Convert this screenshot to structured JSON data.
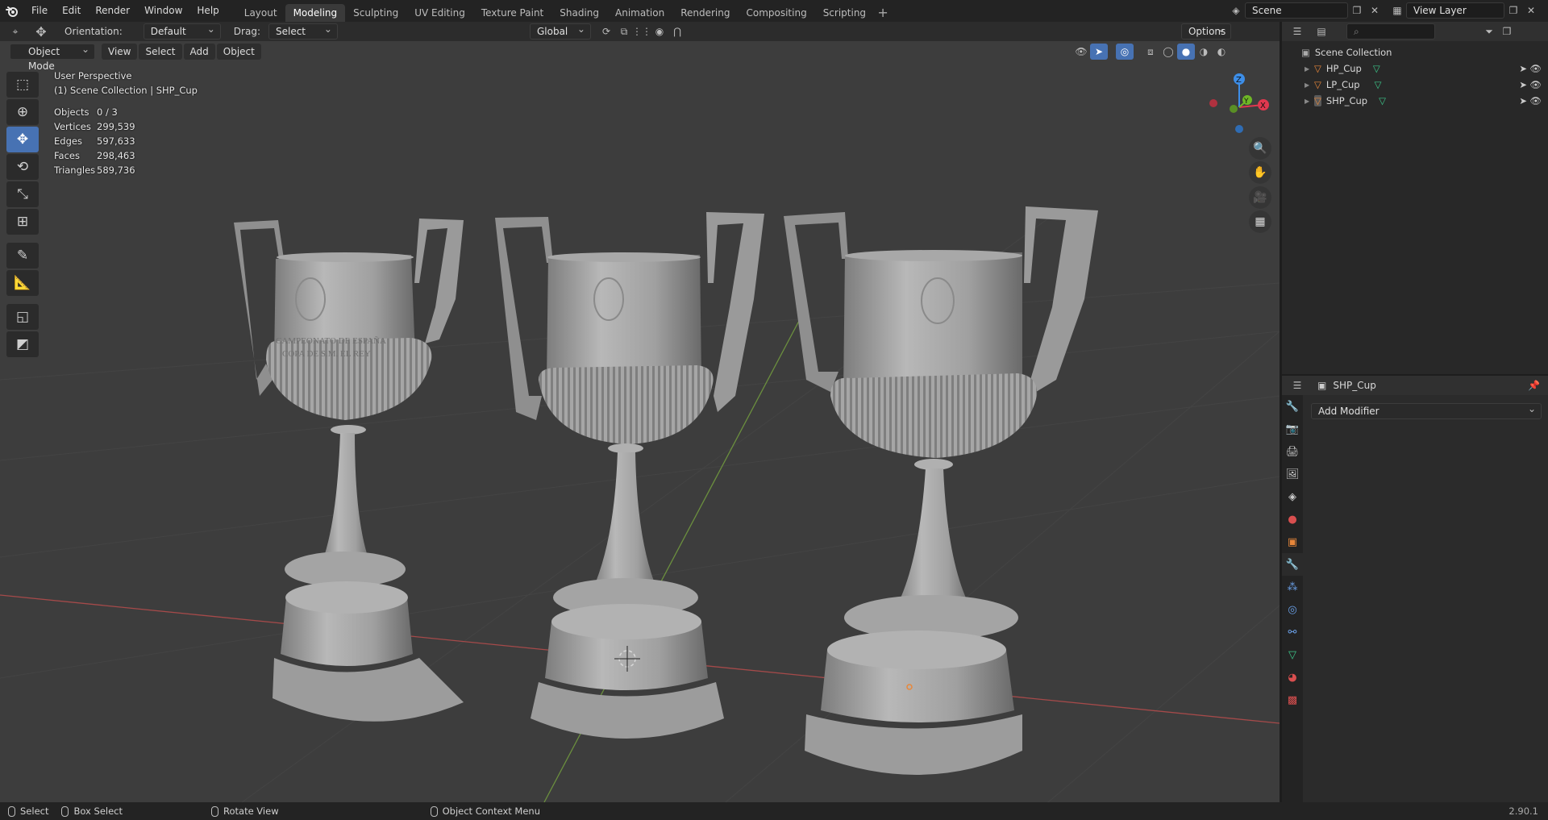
{
  "app": {
    "menus": [
      "File",
      "Edit",
      "Render",
      "Window",
      "Help"
    ],
    "workspace_tabs": [
      "Layout",
      "Modeling",
      "Sculpting",
      "UV Editing",
      "Texture Paint",
      "Shading",
      "Animation",
      "Rendering",
      "Compositing",
      "Scripting"
    ],
    "active_tab": "Modeling",
    "scene": "Scene",
    "view_layer": "View Layer"
  },
  "header": {
    "orientation_label": "Orientation:",
    "orientation_value": "Default",
    "drag_label": "Drag:",
    "drag_value": "Select Box",
    "transform_orientation": "Global",
    "options": "Options"
  },
  "viewport": {
    "mode": "Object Mode",
    "menus": [
      "View",
      "Select",
      "Add",
      "Object"
    ],
    "perspective": "User Perspective",
    "collection": "(1) Scene Collection | SHP_Cup",
    "stats": [
      {
        "label": "Objects",
        "value": "0 / 3"
      },
      {
        "label": "Vertices",
        "value": "299,539"
      },
      {
        "label": "Edges",
        "value": "597,633"
      },
      {
        "label": "Faces",
        "value": "298,463"
      },
      {
        "label": "Triangles",
        "value": "589,736"
      }
    ],
    "gizmo": {
      "z": "Z",
      "y": "Y",
      "x": "X"
    },
    "cup_text": {
      "left_line1": "CAMPEONATO DE ESPAÑA",
      "left_line2": "COPA DE S.M. EL REY"
    }
  },
  "outliner": {
    "root": "Scene Collection",
    "items": [
      "HP_Cup",
      "LP_Cup",
      "SHP_Cup"
    ]
  },
  "properties": {
    "object": "SHP_Cup",
    "add_modifier": "Add Modifier"
  },
  "statusbar": {
    "select": "Select",
    "box_select": "Box Select",
    "rotate": "Rotate View",
    "context": "Object Context Menu",
    "version": "2.90.1"
  },
  "colors": {
    "accent": "#4772b3",
    "axis_x": "#e0384f",
    "axis_y": "#6fb726",
    "axis_z": "#3d8ee8",
    "object_orange": "#e8873a"
  }
}
